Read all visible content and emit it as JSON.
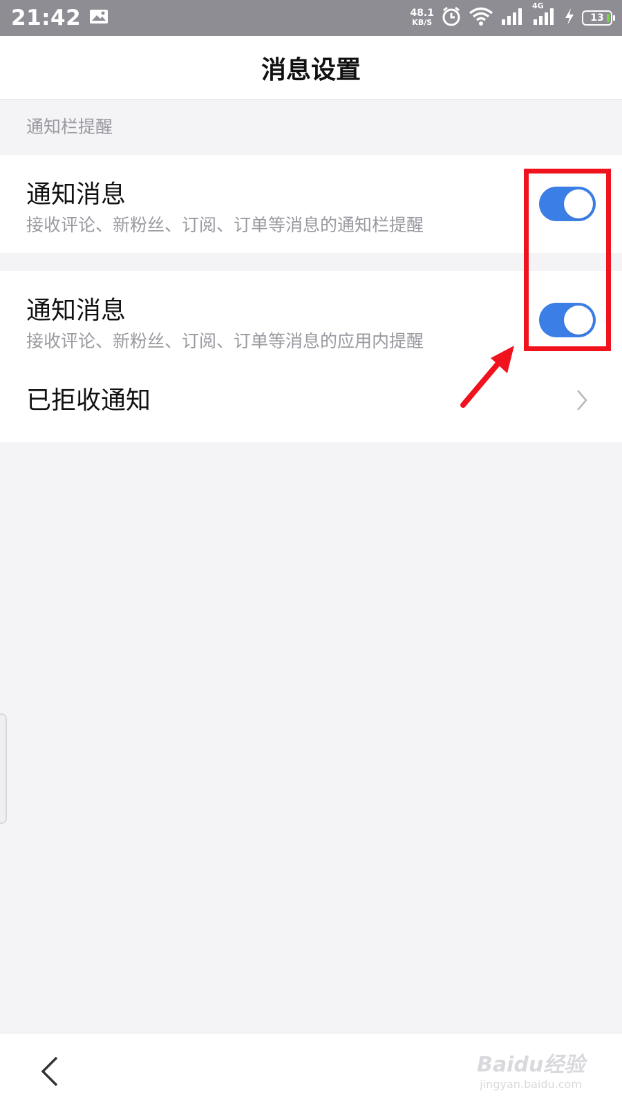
{
  "status_bar": {
    "time": "21:42",
    "speed_value": "48.1",
    "speed_unit": "KB/S",
    "network": "4G",
    "battery": "13"
  },
  "header": {
    "title": "消息设置"
  },
  "section": {
    "label": "通知栏提醒"
  },
  "settings": [
    {
      "title": "通知消息",
      "subtitle": "接收评论、新粉丝、订阅、订单等消息的通知栏提醒",
      "enabled": true
    },
    {
      "title": "通知消息",
      "subtitle": "接收评论、新粉丝、订阅、订单等消息的应用内提醒",
      "enabled": true
    }
  ],
  "rejected": {
    "label": "已拒收通知"
  },
  "watermark": {
    "main": "Baidu经验",
    "sub": "jingyan.baidu.com"
  },
  "colors": {
    "toggle_on": "#3b7ee6",
    "annotation": "#f0121c",
    "status_bar": "#8f8d94"
  }
}
